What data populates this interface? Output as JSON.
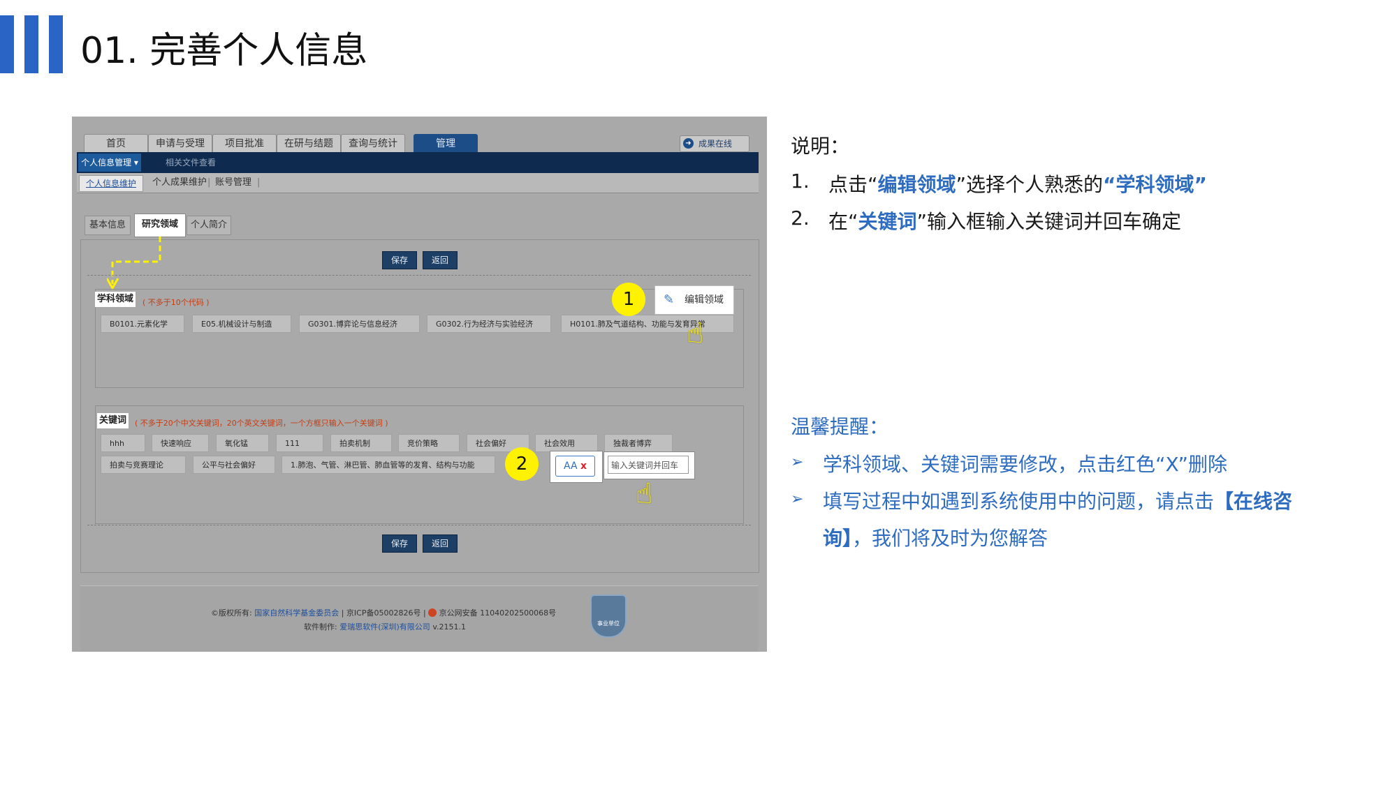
{
  "slide": {
    "title": "01. 完善个人信息"
  },
  "screenshot": {
    "tabs": [
      "首页",
      "申请与受理",
      "项目批准",
      "在研与结题",
      "查询与统计",
      "管理"
    ],
    "results_online": "成果在线",
    "menu": "个人信息管理",
    "menu_sub": "相关文件查看",
    "subnav": {
      "current": "个人信息维护",
      "links": [
        "个人成果维护",
        "|",
        "账号管理",
        "|"
      ]
    },
    "page_tabs": [
      "基本信息",
      "研究领域",
      "个人简介"
    ],
    "buttons": {
      "save": "保存",
      "back": "返回"
    },
    "subject": {
      "label": "学科领域",
      "note": "( 不多于10个代码 )",
      "edit_button": "编辑领域",
      "chips": [
        "B0101.元素化学",
        "E05.机械设计与制造",
        "G0301.博弈论与信息经济",
        "G0302.行为经济与实验经济",
        "H0101.肺及气道结构、功能与发育异常"
      ]
    },
    "keywords": {
      "label": "关键词",
      "note": "( 不多于20个中文关键词，20个英文关键词，一个方框只输入一个关键词 )",
      "row1": [
        "hhh",
        "快速响应",
        "氧化锰",
        "111",
        "拍卖机制",
        "竞价策略",
        "社会偏好",
        "社会效用",
        "独裁者博弈"
      ],
      "row2": [
        "拍卖与竞赛理论",
        "公平与社会偏好",
        "1.肺泡、气管、淋巴管、肺血管等的发育、结构与功能"
      ],
      "chip_example": "AA",
      "chip_remove": "x",
      "input_placeholder": "输入关键词并回车"
    },
    "markers": {
      "one": "1",
      "two": "2"
    },
    "footer": {
      "copyright_prefix": "©版权所有:",
      "org": "国家自然科学基金委员会",
      "icp": "| 京ICP备05002826号 |",
      "police": "京公网安备 11040202500068号",
      "made_by_prefix": "软件制作:",
      "maker": "爱瑞思软件(深圳)有限公司",
      "version": "v.2151.1",
      "badge": "事业单位"
    }
  },
  "instructions": {
    "heading": "说明：",
    "step1": {
      "num": "1.",
      "a": "点击“",
      "b": "编辑领域",
      "c": "”选择个人熟悉的",
      "d": "“学科领域”"
    },
    "step2": {
      "num": "2.",
      "a": "在“",
      "b": "关键词",
      "c": "”输入框输入关键词并回车确定"
    }
  },
  "tips": {
    "heading": "温馨提醒：",
    "tip1": "学科领域、关键词需要修改，点击红色“X”删除",
    "tip2_a": "填写过程中如遇到系统使用中的问题，请点击",
    "tip2_b": "【在线咨",
    "tip2_c": "询】",
    "tip2_d": "，我们将及时为您解答"
  },
  "colors": {
    "accent": "#2a64c5",
    "tip_blue": "#2e6cc0",
    "highlight": "#fff200",
    "nav_dark": "#0e2a4e"
  }
}
